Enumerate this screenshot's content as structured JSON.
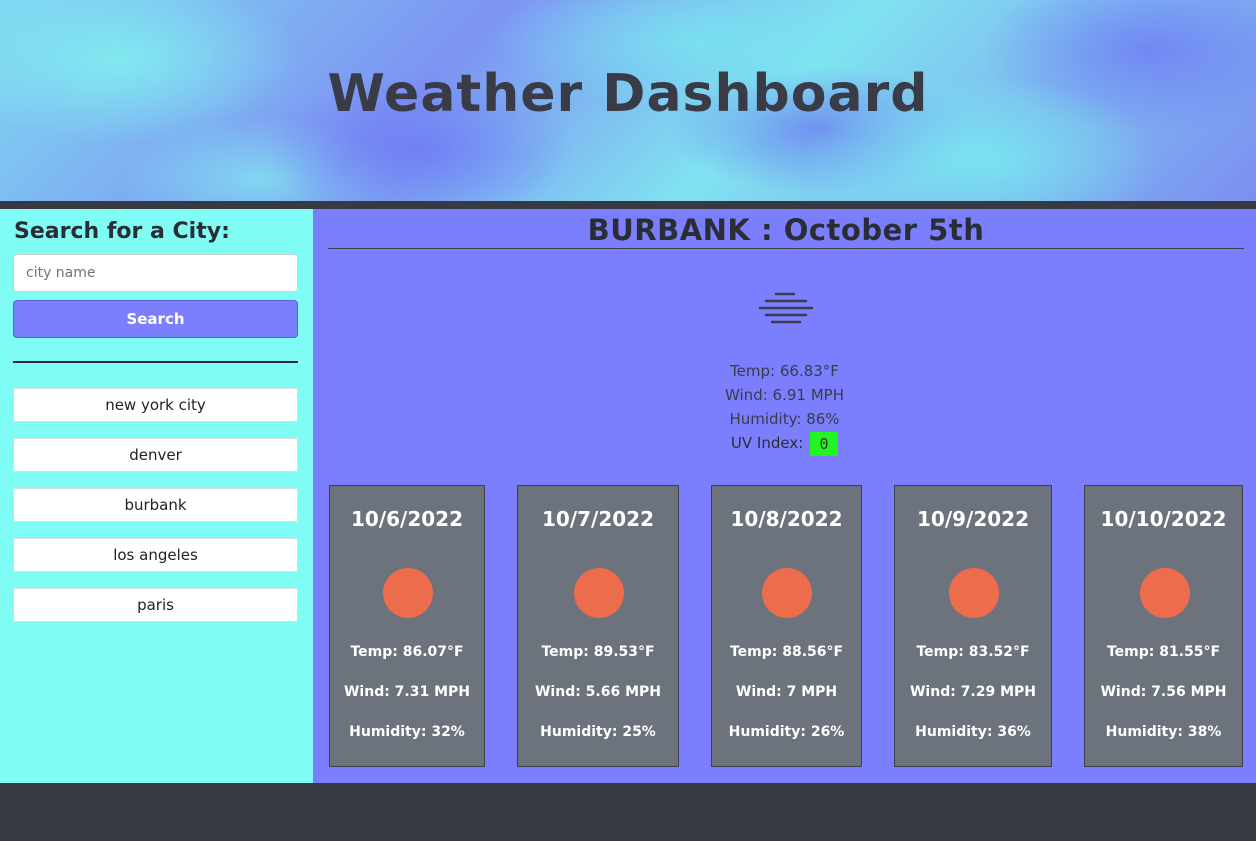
{
  "header": {
    "title": "Weather Dashboard"
  },
  "sidebar": {
    "title": "Search for a City:",
    "search_placeholder": "city name",
    "search_value": "",
    "search_button": "Search",
    "history": [
      "new york city",
      "denver",
      "burbank",
      "los angeles",
      "paris"
    ]
  },
  "current": {
    "city": "BURBANK",
    "separator": ":",
    "date": "October 5th",
    "icon": "fog-icon",
    "temp": "Temp: 66.83°F",
    "wind": "Wind: 6.91 MPH",
    "humidity": "Humidity: 86%",
    "uv_label": "UV Index:",
    "uv_value": "0",
    "uv_color": "#22f522"
  },
  "forecast": [
    {
      "date": "10/6/2022",
      "icon": "sun-icon",
      "temp": "Temp: 86.07°F",
      "wind": "Wind: 7.31 MPH",
      "humidity": "Humidity: 32%"
    },
    {
      "date": "10/7/2022",
      "icon": "sun-icon",
      "temp": "Temp: 89.53°F",
      "wind": "Wind: 5.66 MPH",
      "humidity": "Humidity: 25%"
    },
    {
      "date": "10/8/2022",
      "icon": "sun-icon",
      "temp": "Temp: 88.56°F",
      "wind": "Wind: 7 MPH",
      "humidity": "Humidity: 26%"
    },
    {
      "date": "10/9/2022",
      "icon": "sun-icon",
      "temp": "Temp: 83.52°F",
      "wind": "Wind: 7.29 MPH",
      "humidity": "Humidity: 36%"
    },
    {
      "date": "10/10/2022",
      "icon": "sun-icon",
      "temp": "Temp: 81.55°F",
      "wind": "Wind: 7.56 MPH",
      "humidity": "Humidity: 38%"
    }
  ],
  "colors": {
    "sidebar_bg": "#7ffcf3",
    "main_bg": "#7b7ffd",
    "card_bg": "#6c737c",
    "sun": "#ed6c4c",
    "dark": "#383a43"
  }
}
